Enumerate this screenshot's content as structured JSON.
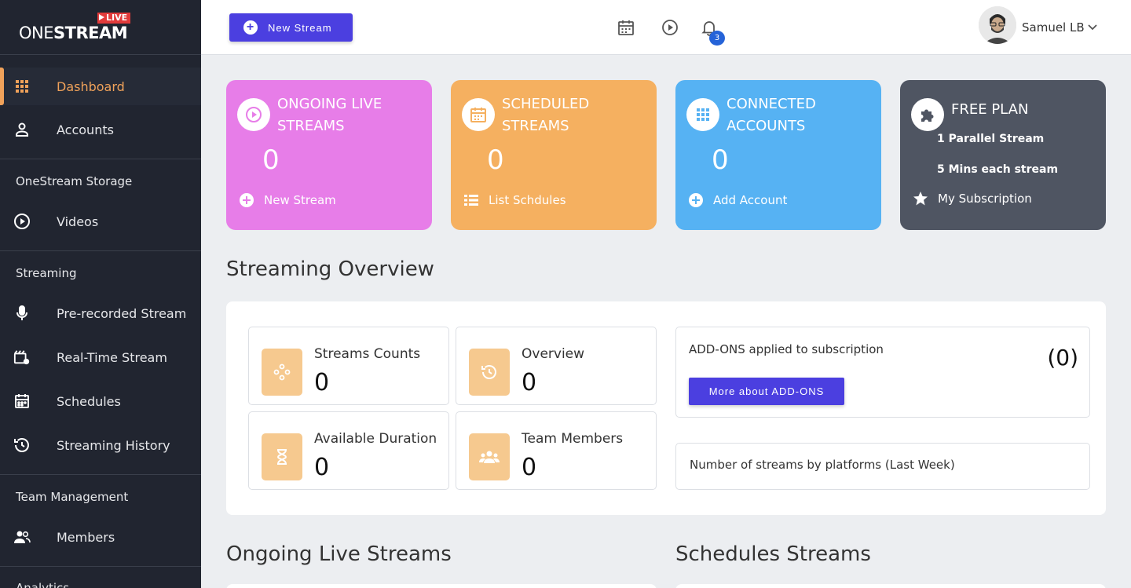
{
  "logo": {
    "one": "ONE",
    "stream": "STREAM",
    "live": "LIVE"
  },
  "sidebar": {
    "items": [
      {
        "label": "Dashboard",
        "icon": "grid-icon"
      },
      {
        "label": "Accounts",
        "icon": "user-icon"
      },
      {
        "label": "Videos",
        "icon": "play-circle-icon"
      },
      {
        "label": "Pre-recorded Stream",
        "icon": "microphone-icon"
      },
      {
        "label": "Real-Time Stream",
        "icon": "video-settings-icon"
      },
      {
        "label": "Schedules",
        "icon": "calendar-icon"
      },
      {
        "label": "Streaming History",
        "icon": "history-icon"
      },
      {
        "label": "Members",
        "icon": "users-icon"
      }
    ],
    "sections": [
      "OneStream Storage",
      "Streaming",
      "Team Management",
      "Analytics"
    ]
  },
  "topbar": {
    "new_stream": "New Stream",
    "notification_count": "3",
    "user_name": "Samuel LB"
  },
  "cards": {
    "ongoing": {
      "title": "ONGOING LIVE STREAMS",
      "value": "0",
      "link": "New Stream"
    },
    "scheduled": {
      "title": "SCHEDULED STREAMS",
      "value": "0",
      "link": "List Schdules"
    },
    "connected": {
      "title": "CONNECTED ACCOUNTS",
      "value": "0",
      "link": "Add Account"
    },
    "plan": {
      "title": "FREE PLAN",
      "line1": "1 Parallel Stream",
      "line2": "5 Mins each stream",
      "link": "My Subscription"
    }
  },
  "overview": {
    "heading": "Streaming Overview",
    "stats": [
      {
        "label": "Streams Counts",
        "value": "0"
      },
      {
        "label": "Overview",
        "value": "0"
      },
      {
        "label": "Available Duration",
        "value": "0"
      },
      {
        "label": "Team Members",
        "value": "0"
      }
    ],
    "addons_title": "ADD-ONS applied to subscription",
    "addons_count": "(0)",
    "addons_button": "More about ADD-ONS",
    "platforms_title": "Number of streams by platforms (Last Week)"
  },
  "sections": {
    "ongoing_heading": "Ongoing Live Streams",
    "schedules_heading": "Schedules Streams"
  },
  "colors": {
    "sidebar_bg": "#212530",
    "accent_orange": "#f0a25a",
    "primary_button": "#4b3fe0",
    "card_pink": "#e77de8",
    "card_orange": "#f5b060",
    "card_blue": "#56b2f3",
    "card_gray": "#4f5562"
  }
}
